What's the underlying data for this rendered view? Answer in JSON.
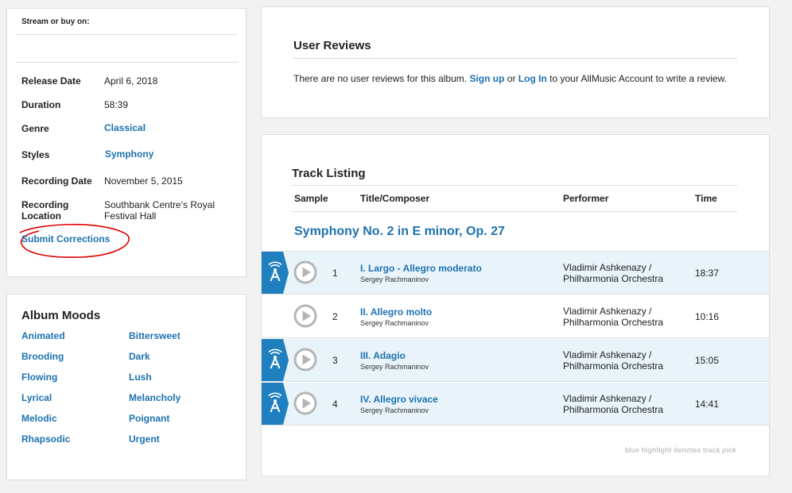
{
  "details": {
    "stream_label": "Stream or buy on:",
    "rows": [
      {
        "key": "Release Date",
        "value": "April 6, 2018"
      },
      {
        "key": "Duration",
        "value": "58:39"
      },
      {
        "key": "Genre",
        "value": "Classical"
      },
      {
        "key": "Styles",
        "value": "Symphony"
      },
      {
        "key": "Recording Date",
        "value": "November 5, 2015"
      },
      {
        "key": "Recording Location",
        "value": "Southbank Centre's Royal Festival Hall"
      }
    ],
    "submit_corrections": "Submit Corrections"
  },
  "moods": {
    "title": "Album Moods",
    "items": [
      "Animated",
      "Bittersweet",
      "Brooding",
      "Dark",
      "Flowing",
      "Lush",
      "Lyrical",
      "Melancholy",
      "Melodic",
      "Poignant",
      "Rhapsodic",
      "Urgent"
    ]
  },
  "reviews": {
    "title": "User Reviews",
    "text_before": "There are no user reviews for this album.",
    "sign_up": "Sign up",
    "or": "or",
    "log_in": "Log In",
    "text_after": "to your AllMusic Account to write a review."
  },
  "tracks": {
    "title": "Track Listing",
    "columns": {
      "sample": "Sample",
      "title": "Title/Composer",
      "performer": "Performer",
      "time": "Time"
    },
    "work_title": "Symphony No. 2 in E minor, Op. 27",
    "rows": [
      {
        "num": "1",
        "title": "I. Largo - Allegro moderato",
        "composer": "Sergey Rachmaninov",
        "performer": "Vladimir Ashkenazy / Philharmonia Orchestra",
        "time": "18:37",
        "pick": true
      },
      {
        "num": "2",
        "title": "II. Allegro molto",
        "composer": "Sergey Rachmaninov",
        "performer": "Vladimir Ashkenazy / Philharmonia Orchestra",
        "time": "10:16",
        "pick": false
      },
      {
        "num": "3",
        "title": "III. Adagio",
        "composer": "Sergey Rachmaninov",
        "performer": "Vladimir Ashkenazy / Philharmonia Orchestra",
        "time": "15:05",
        "pick": true
      },
      {
        "num": "4",
        "title": "IV. Allegro vivace",
        "composer": "Sergey Rachmaninov",
        "performer": "Vladimir Ashkenazy / Philharmonia Orchestra",
        "time": "14:41",
        "pick": true
      }
    ],
    "pick_note": "blue highlight denotes track pick"
  },
  "colors": {
    "link": "#1d72b0",
    "pick_highlight": "#e8f4fa",
    "pick_badge": "#1f7fbf",
    "annotation": "#e00000"
  },
  "icons": {
    "pick": "track-pick-icon",
    "play": "play-icon"
  }
}
